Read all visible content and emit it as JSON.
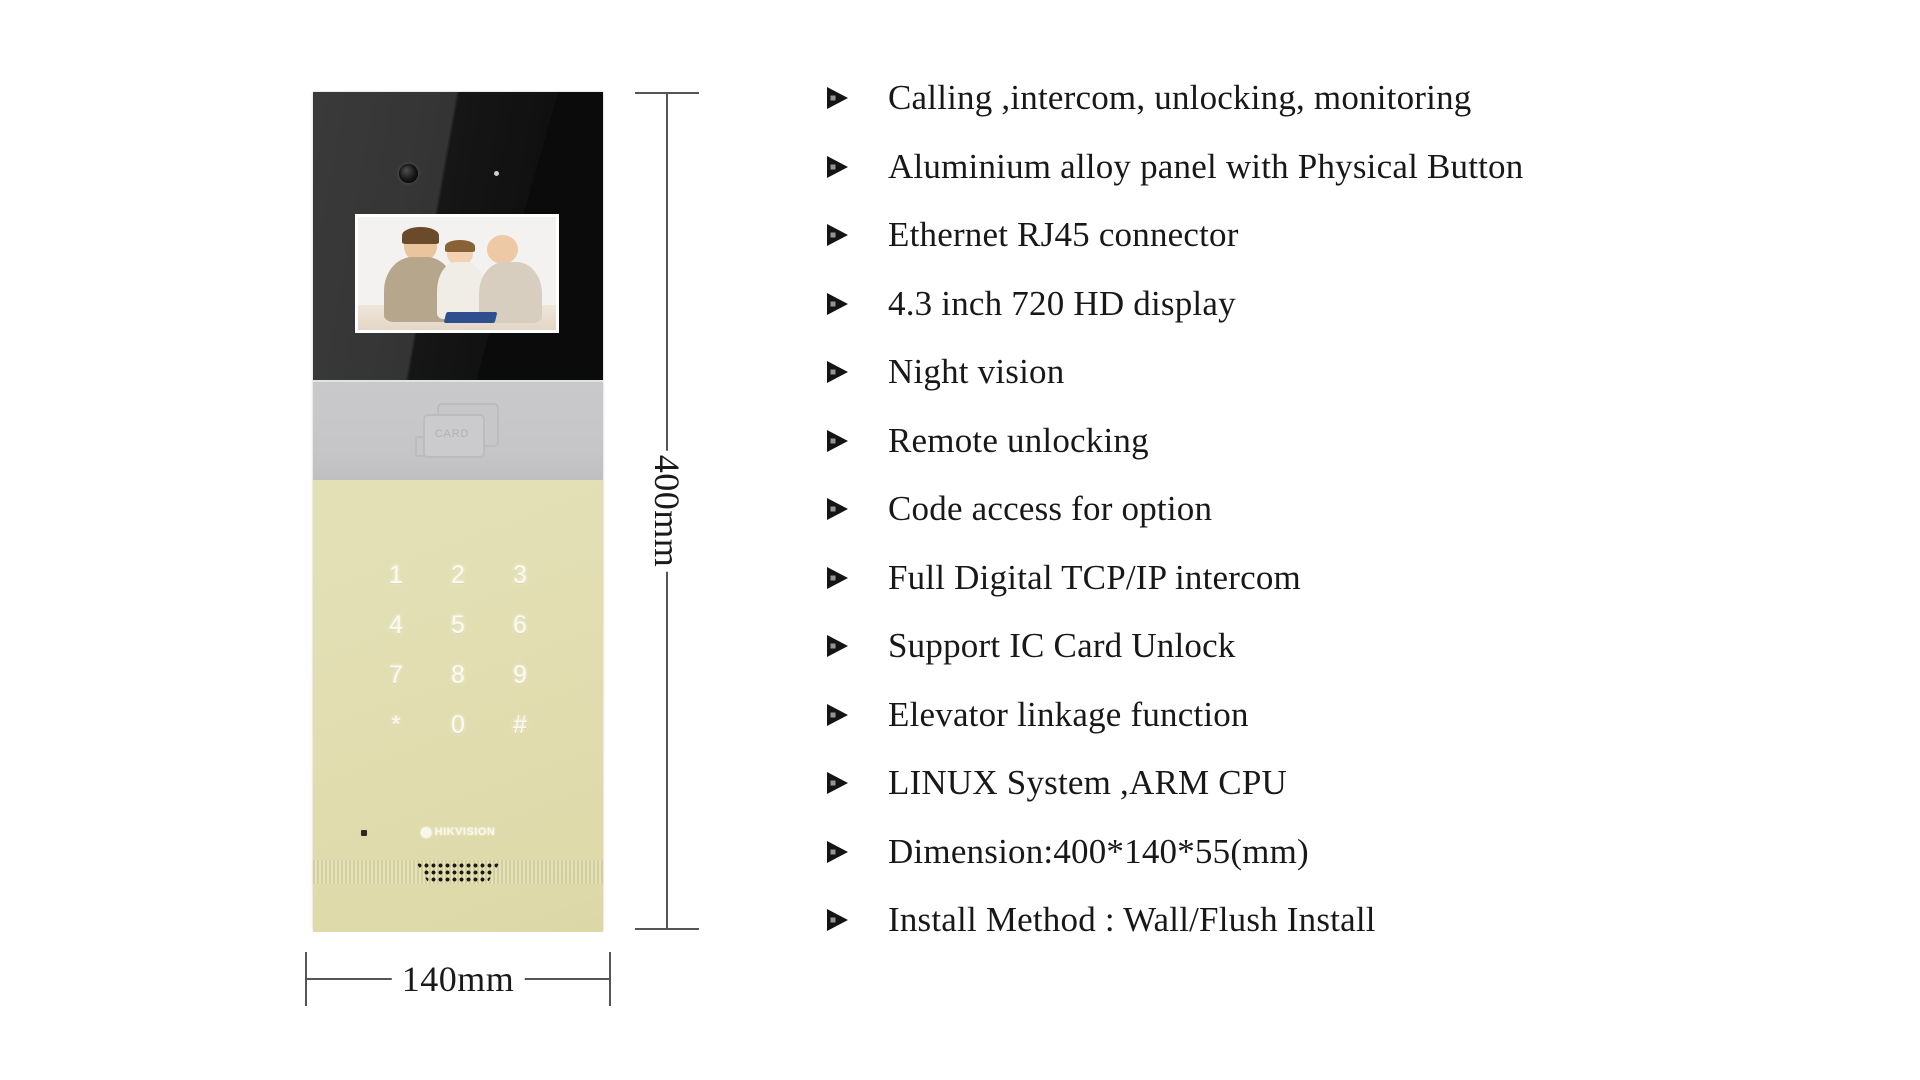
{
  "product": {
    "device_name": "video door phone outdoor station",
    "brand_mark": "HIKVISION",
    "card_reader_label": "CARD",
    "keypad_keys": [
      "1",
      "2",
      "3",
      "4",
      "5",
      "6",
      "7",
      "8",
      "9",
      "*",
      "0",
      "#"
    ],
    "screen_caption": "family video preview"
  },
  "dimensions": {
    "height_label": "400mm",
    "width_label": "140mm"
  },
  "features": {
    "bullet_icon": "triangle-right-icon",
    "items": [
      "Calling ,intercom, unlocking, monitoring",
      "Aluminium alloy panel with Physical Button",
      "Ethernet RJ45 connector",
      " 4.3  inch 720 HD display",
      "Night vision",
      "Remote unlocking",
      "Code access for option",
      "Full Digital TCP/IP intercom",
      "Support IC Card Unlock",
      "Elevator linkage function",
      "LINUX System ,ARM CPU",
      "Dimension:400*140*55(mm)",
      "Install Method : Wall/Flush Install"
    ]
  },
  "colors": {
    "background": "#ffffff",
    "text": "#181818",
    "dimension_line": "#555555",
    "panel_black": "#121212",
    "panel_gray": "#c6c6c8",
    "panel_khaki": "#e1ddb0"
  }
}
